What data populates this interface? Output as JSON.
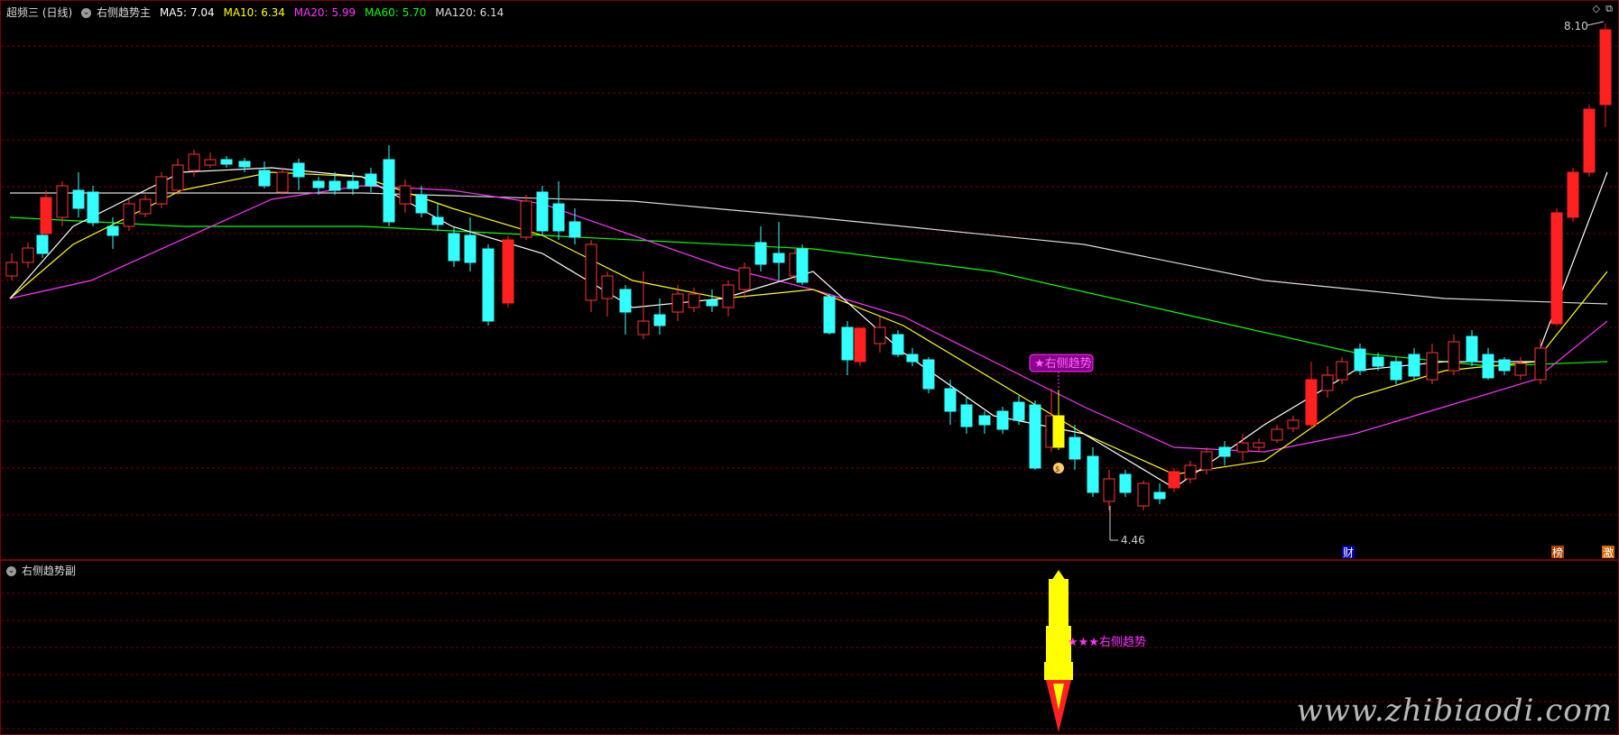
{
  "main_panel": {
    "indicator_name": "超频三 (日线)",
    "formula_name": "右侧趋势主",
    "ma": [
      {
        "label": "MA5:",
        "value": "7.04",
        "color": "#ffffff"
      },
      {
        "label": "MA10:",
        "value": "6.34",
        "color": "#ffff00"
      },
      {
        "label": "MA20:",
        "value": "5.99",
        "color": "#ff33ff"
      },
      {
        "label": "MA60:",
        "value": "5.70",
        "color": "#00ff00"
      },
      {
        "label": "MA120:",
        "value": "6.14",
        "color": "#dddddd"
      }
    ],
    "high_label": "8.10",
    "low_label": "4.46",
    "signal_tag": "★右侧趋势",
    "markers": {
      "cai": "财",
      "bang": "榜",
      "ji": "激"
    }
  },
  "sub_panel": {
    "formula_name": "右侧趋势副",
    "rocket_label": "★★★右侧趋势"
  },
  "watermark": "www.zhibiaodi.com",
  "colors": {
    "up": "#ff2020",
    "down": "#33ffff",
    "signal": "#ffff00",
    "grid": "#7a0000"
  }
}
